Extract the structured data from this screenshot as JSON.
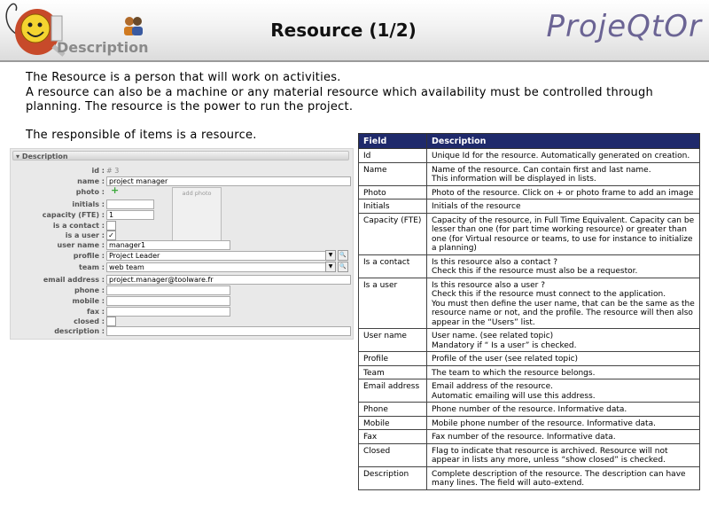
{
  "header": {
    "title": "Resource (1/2)",
    "brand": "ProjeQtOr",
    "section_label": "Description"
  },
  "intro": {
    "line1": "The Resource is a person that will work on activities.",
    "line2": "A resource can also be a machine or any material resource which availability must be controlled through planning. The resource is the power to run the project.",
    "responsible": "The responsible of items is a resource."
  },
  "form": {
    "section_title": "Description",
    "labels": {
      "id": "id :",
      "name": "name :",
      "photo": "photo :",
      "initials": "initials :",
      "capacity": "capacity (FTE) :",
      "is_contact": "is a contact :",
      "is_user": "is a user :",
      "user_name": "user name :",
      "profile": "profile :",
      "team": "team :",
      "email": "email address :",
      "phone": "phone :",
      "mobile": "mobile :",
      "fax": "fax :",
      "closed": "closed :",
      "description": "description :"
    },
    "values": {
      "id": "# 3",
      "name": "project manager",
      "capacity": "1",
      "is_user_check": "✓",
      "user_name": "manager1",
      "profile": "Project Leader",
      "team": "web team",
      "email": "project.manager@toolware.fr"
    },
    "photo_frame_label": "add photo",
    "add_photo_icon": "+"
  },
  "table": {
    "headers": [
      "Field",
      "Description"
    ],
    "rows": [
      {
        "field": "Id",
        "desc": [
          "Unique Id for the resource. Automatically generated on creation."
        ]
      },
      {
        "field": "Name",
        "desc": [
          "Name of the resource. Can contain first and last name.",
          "This information will be displayed in lists."
        ]
      },
      {
        "field": "Photo",
        "desc": [
          "Photo of the resource. Click on + or photo frame to add an image"
        ]
      },
      {
        "field": "Initials",
        "desc": [
          "Initials of the resource"
        ]
      },
      {
        "field": "Capacity (FTE)",
        "desc": [
          "Capacity of the resource, in Full Time Equivalent. Capacity can be lesser than one (for part time working resource) or greater than one (for Virtual resource or teams, to use for instance to initialize a planning)"
        ]
      },
      {
        "field": "Is a contact",
        "desc": [
          "Is this resource also a contact ?",
          "Check this if the resource must also be a requestor."
        ]
      },
      {
        "field": "Is a user",
        "desc": [
          "Is this resource also a user ?",
          "Check this if the resource must connect to the application.",
          "You must then define the user name, that can be the same as the resource name or not, and the profile. The resource will then also appear in the “Users” list."
        ]
      },
      {
        "field": "User name",
        "desc": [
          "User name. (see related topic)",
          "Mandatory if “ Is a user” is checked."
        ]
      },
      {
        "field": "Profile",
        "desc": [
          "Profile of the user (see related topic)"
        ]
      },
      {
        "field": "Team",
        "desc": [
          "The team to which the resource belongs."
        ]
      },
      {
        "field": "Email address",
        "desc": [
          "Email address of the resource.",
          "Automatic emailing will use this address."
        ]
      },
      {
        "field": "Phone",
        "desc": [
          "Phone number of the resource. Informative data."
        ]
      },
      {
        "field": "Mobile",
        "desc": [
          "Mobile phone number of the resource. Informative data."
        ]
      },
      {
        "field": "Fax",
        "desc": [
          "Fax number of the resource. Informative data."
        ]
      },
      {
        "field": "Closed",
        "desc": [
          "Flag to indicate that resource is archived. Resource will not appear in lists any more, unless “show closed” is checked."
        ]
      },
      {
        "field": "Description",
        "desc": [
          "Complete description of the resource. The description can have many lines. The field will auto-extend."
        ]
      }
    ]
  },
  "colors": {
    "table_header_bg": "#1f2a6b",
    "brand": "#6b6494"
  },
  "icons": [
    "mascot-logo",
    "users-icon",
    "add-photo-plus-icon",
    "chevron-down-icon",
    "search-icon"
  ]
}
